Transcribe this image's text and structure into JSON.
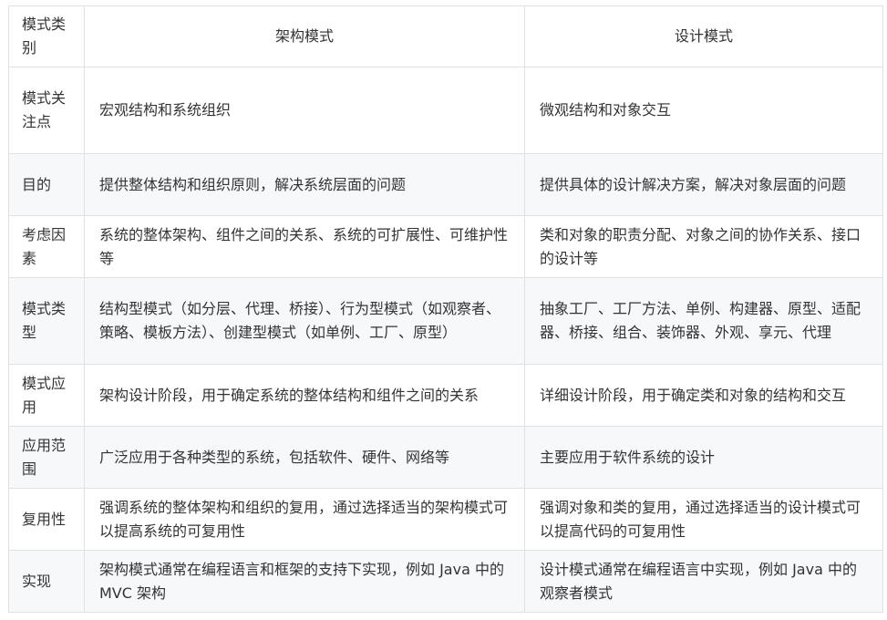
{
  "table": {
    "headers": [
      "模式类别",
      "架构模式",
      "设计模式"
    ],
    "rows": [
      [
        "模式关注点",
        "宏观结构和系统组织",
        "微观结构和对象交互"
      ],
      [
        "目的",
        "提供整体结构和组织原则，解决系统层面的问题",
        "提供具体的设计解决方案，解决对象层面的问题"
      ],
      [
        "考虑因素",
        "系统的整体架构、组件之间的关系、系统的可扩展性、可维护性等",
        "类和对象的职责分配、对象之间的协作关系、接口的设计等"
      ],
      [
        "模式类型",
        "结构型模式（如分层、代理、桥接）、行为型模式（如观察者、策略、模板方法）、创建型模式（如单例、工厂、原型）",
        "抽象工厂、工厂方法、单例、构建器、原型、适配器、桥接、组合、装饰器、外观、享元、代理"
      ],
      [
        "模式应用",
        "架构设计阶段，用于确定系统的整体结构和组件之间的关系",
        "详细设计阶段，用于确定类和对象的结构和交互"
      ],
      [
        "应用范围",
        "广泛应用于各种类型的系统，包括软件、硬件、网络等",
        "主要应用于软件系统的设计"
      ],
      [
        "复用性",
        "强调系统的整体架构和组织的复用，通过选择适当的架构模式可以提高系统的可复用性",
        "强调对象和类的复用，通过选择适当的设计模式可以提高代码的可复用性"
      ],
      [
        "实现",
        "架构模式通常在编程语言和框架的支持下实现，例如 Java 中的 MVC 架构",
        "设计模式通常在编程语言中实现，例如 Java 中的观察者模式"
      ]
    ]
  }
}
